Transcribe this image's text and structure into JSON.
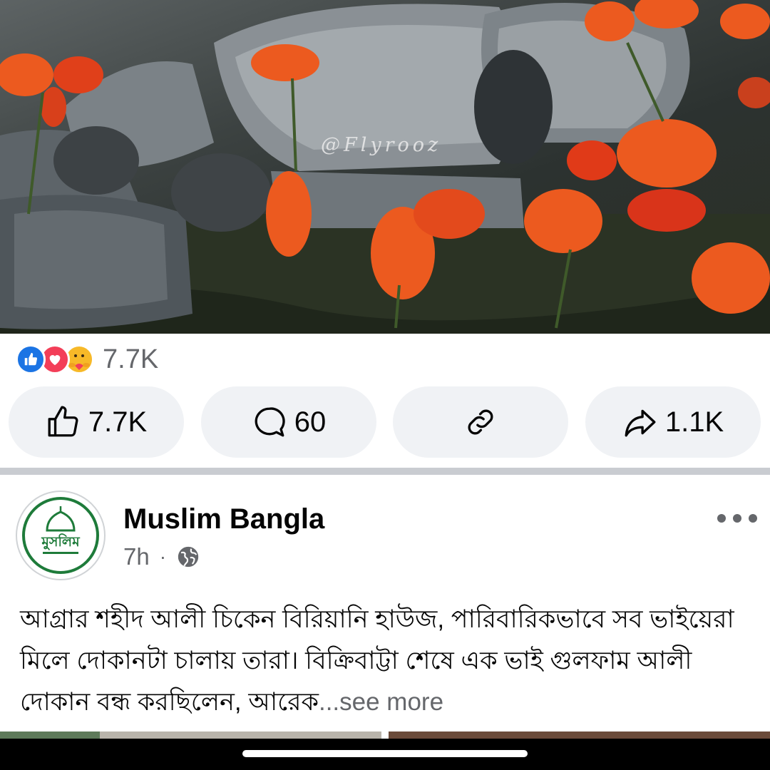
{
  "post_image": {
    "watermark": "@Flyrooz"
  },
  "reactions": {
    "types": [
      "like-icon",
      "love-icon",
      "care-icon"
    ],
    "count": "7.7K"
  },
  "actions": {
    "like_count": "7.7K",
    "comment_count": "60",
    "share_count": "1.1K"
  },
  "post2": {
    "page_name": "Muslim Bangla",
    "time": "7h",
    "separator": "·",
    "avatar_text": "মুসলিম",
    "post_text": "আগ্রার শহীদ আলী চিকেন বিরিয়ানি হাউজ, পারিবারিকভাবে সব ভাইয়েরা মিলে দোকানটা চালায় তারা। বিক্রিবাট্টা শেষে এক ভাই গুলফাম আলী দোকান বন্ধ করছিলেন, আরেক",
    "see_more": "...see more"
  },
  "colors": {
    "brand_blue": "#1b74e4",
    "love_red": "#f33e58",
    "care_yellow": "#f7b928",
    "logo_green": "#1e7b3a",
    "button_bg": "#f0f2f5",
    "muted_text": "#65676b"
  }
}
